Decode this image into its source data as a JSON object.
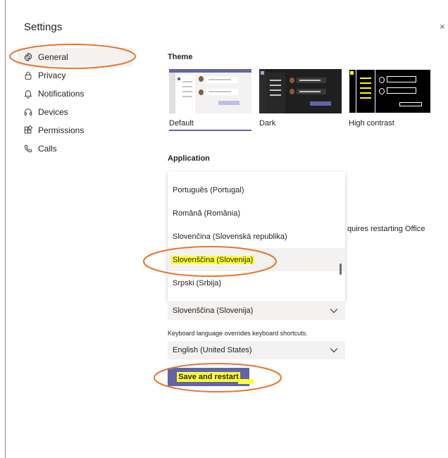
{
  "window": {
    "title": "Settings",
    "close_glyph": "×"
  },
  "sidebar": {
    "items": [
      {
        "label": "General",
        "icon": "gear-icon",
        "active": true
      },
      {
        "label": "Privacy",
        "icon": "lock-icon"
      },
      {
        "label": "Notifications",
        "icon": "bell-icon"
      },
      {
        "label": "Devices",
        "icon": "headset-icon"
      },
      {
        "label": "Permissions",
        "icon": "apps-icon"
      },
      {
        "label": "Calls",
        "icon": "phone-icon"
      }
    ]
  },
  "theme": {
    "heading": "Theme",
    "options": [
      {
        "label": "Default",
        "selected": true
      },
      {
        "label": "Dark"
      },
      {
        "label": "High contrast"
      }
    ]
  },
  "application": {
    "heading": "Application",
    "language_options": [
      "Português (Portugal)",
      "Română (România)",
      "Slovenčina (Slovenská republika)",
      "Slovenščina (Slovenija)",
      "Srpski (Srbija)"
    ],
    "restart_note": "quires restarting Office",
    "app_language_value": "Slovenščina (Slovenija)",
    "keyboard_note": "Keyboard language overrides keyboard shortcuts.",
    "keyboard_language_value": "English (United States)",
    "save_button": "Save and restart"
  },
  "colors": {
    "accent": "#6264a7",
    "highlight": "#ffff3a",
    "annotation": "#e8762b"
  }
}
